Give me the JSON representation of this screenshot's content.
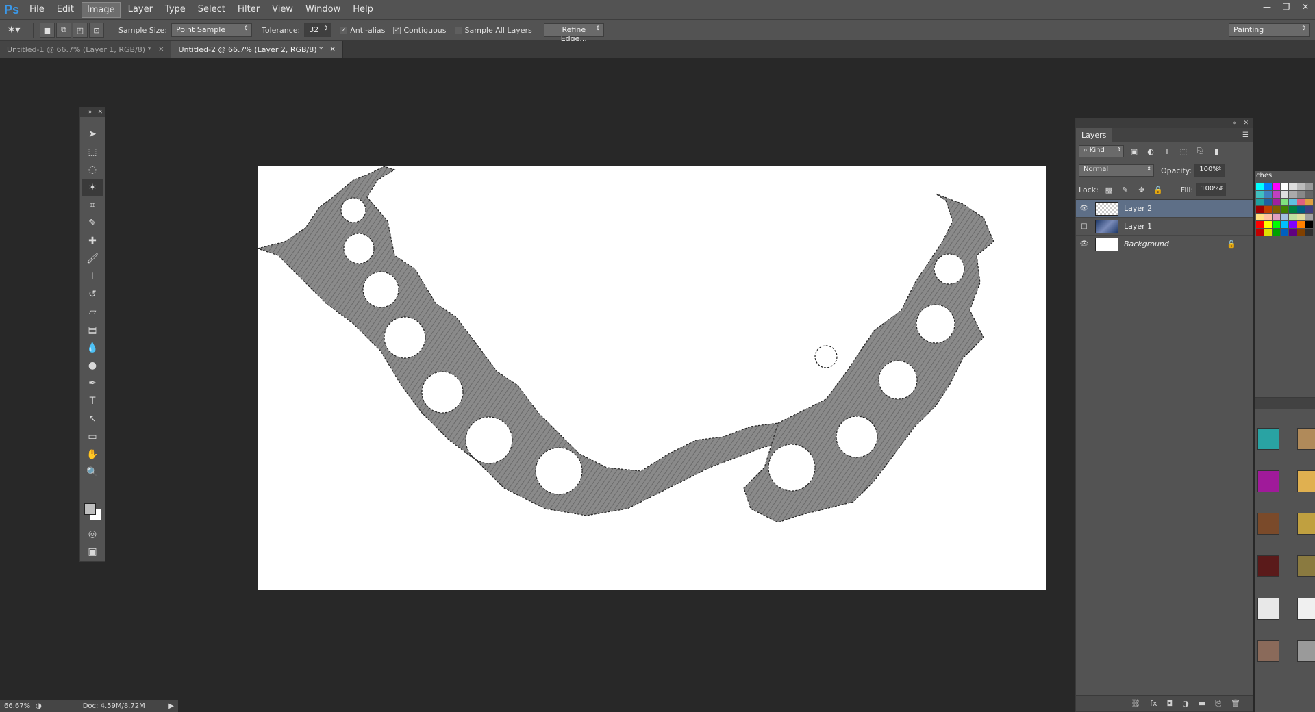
{
  "app": {
    "logo": "Ps"
  },
  "menu": [
    "File",
    "Edit",
    "Image",
    "Layer",
    "Type",
    "Select",
    "Filter",
    "View",
    "Window",
    "Help"
  ],
  "active_menu_index": 2,
  "window_controls": [
    "—",
    "❐",
    "✕"
  ],
  "options_bar": {
    "sample_size_label": "Sample Size:",
    "sample_size_value": "Point Sample",
    "tolerance_label": "Tolerance:",
    "tolerance_value": "32",
    "anti_alias": "Anti-alias",
    "contiguous": "Contiguous",
    "sample_all_layers": "Sample All Layers",
    "refine_edge": "Refine Edge...",
    "workspace": "Painting"
  },
  "tabs": [
    {
      "label": "Untitled-1 @ 66.7% (Layer 1, RGB/8) *",
      "active": false
    },
    {
      "label": "Untitled-2 @ 66.7% (Layer 2, RGB/8) *",
      "active": true
    }
  ],
  "layers_panel": {
    "title": "Layers",
    "kind_label": "Kind",
    "blend_mode": "Normal",
    "opacity_label": "Opacity:",
    "opacity_value": "100%",
    "lock_label": "Lock:",
    "fill_label": "Fill:",
    "fill_value": "100%",
    "layers": [
      {
        "name": "Layer 2",
        "visible": true,
        "selected": true
      },
      {
        "name": "Layer 1",
        "visible": false,
        "selected": false
      },
      {
        "name": "Background",
        "visible": true,
        "selected": false,
        "locked": true
      }
    ]
  },
  "swatches_tab": "ches",
  "status": {
    "zoom": "66.67%",
    "doc": "Doc: 4.59M/8.72M"
  }
}
